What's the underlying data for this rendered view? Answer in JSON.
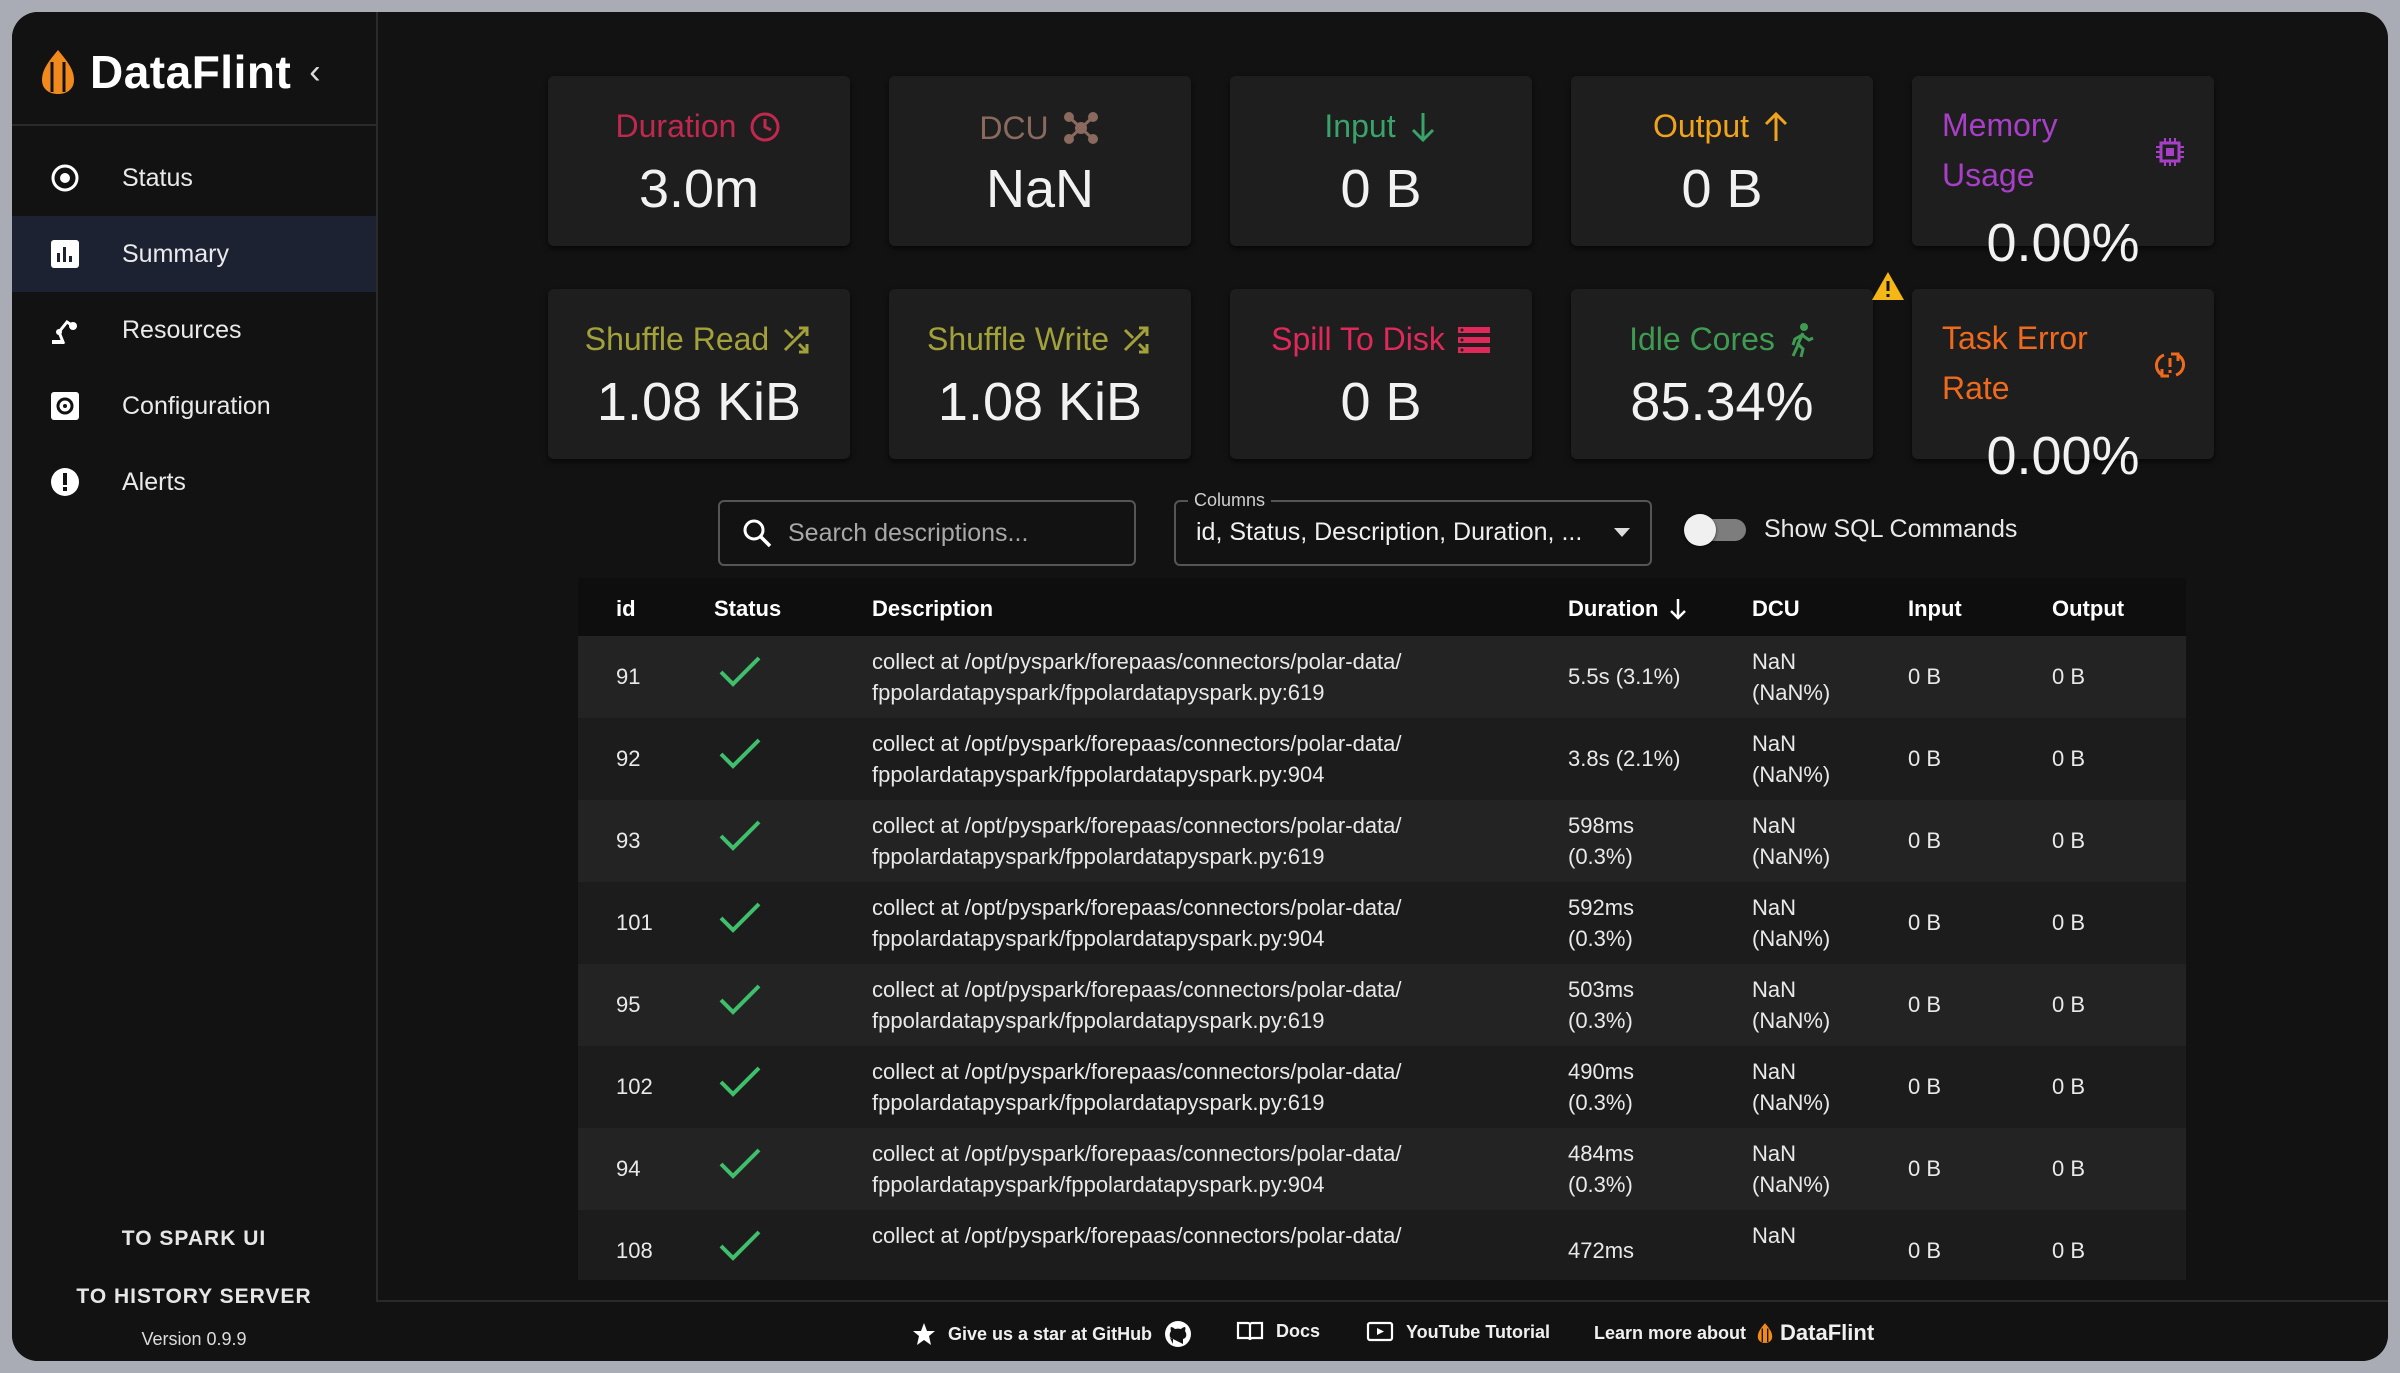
{
  "app": {
    "name": "DataFlint",
    "version": "Version 0.9.9"
  },
  "sidebar": {
    "items": [
      {
        "label": "Status",
        "icon": "status-icon"
      },
      {
        "label": "Summary",
        "icon": "summary-chart-icon",
        "active": true
      },
      {
        "label": "Resources",
        "icon": "resources-icon"
      },
      {
        "label": "Configuration",
        "icon": "configuration-icon"
      },
      {
        "label": "Alerts",
        "icon": "alert-icon"
      }
    ],
    "to_spark_ui": "TO SPARK UI",
    "to_history_server": "TO HISTORY SERVER"
  },
  "metrics": [
    {
      "title": "Duration",
      "value": "3.0m",
      "color": "#c0284e"
    },
    {
      "title": "DCU",
      "value": "NaN",
      "color": "#8a6a5e"
    },
    {
      "title": "Input",
      "value": "0 B",
      "color": "#39a36a"
    },
    {
      "title": "Output",
      "value": "0 B",
      "color": "#f0a41c"
    },
    {
      "title": "Memory Usage",
      "value": "0.00%",
      "color": "#a83fc7"
    },
    {
      "title": "Shuffle Read",
      "value": "1.08 KiB",
      "color": "#a3a13a"
    },
    {
      "title": "Shuffle Write",
      "value": "1.08 KiB",
      "color": "#a3a13a"
    },
    {
      "title": "Spill To Disk",
      "value": "0 B",
      "color": "#e0285a"
    },
    {
      "title": "Idle Cores",
      "value": "85.34%",
      "color": "#3f9a52",
      "warning": true
    },
    {
      "title": "Task Error Rate",
      "value": "0.00%",
      "color": "#ef6a1d"
    }
  ],
  "toolbar": {
    "search_placeholder": "Search descriptions...",
    "columns_label": "Columns",
    "columns_value": "id, Status, Description, Duration, ...",
    "show_sql_label": "Show SQL Commands",
    "show_sql_on": false
  },
  "table": {
    "headers": {
      "id": "id",
      "status": "Status",
      "description": "Description",
      "duration": "Duration",
      "dcu": "DCU",
      "input": "Input",
      "output": "Output"
    },
    "sort_column": "Duration",
    "rows": [
      {
        "id": "91",
        "status": "success",
        "desc1": "collect at /opt/pyspark/forepaas/connectors/polar-data/",
        "desc2": "fppolardatapyspark/fppolardatapyspark.py:619",
        "duration": "5.5s (3.1%)",
        "duration2": "",
        "dcu1": "NaN",
        "dcu2": "(NaN%)",
        "input": "0 B",
        "output": "0 B"
      },
      {
        "id": "92",
        "status": "success",
        "desc1": "collect at /opt/pyspark/forepaas/connectors/polar-data/",
        "desc2": "fppolardatapyspark/fppolardatapyspark.py:904",
        "duration": "3.8s (2.1%)",
        "duration2": "",
        "dcu1": "NaN",
        "dcu2": "(NaN%)",
        "input": "0 B",
        "output": "0 B"
      },
      {
        "id": "93",
        "status": "success",
        "desc1": "collect at /opt/pyspark/forepaas/connectors/polar-data/",
        "desc2": "fppolardatapyspark/fppolardatapyspark.py:619",
        "duration": "598ms",
        "duration2": "(0.3%)",
        "dcu1": "NaN",
        "dcu2": "(NaN%)",
        "input": "0 B",
        "output": "0 B"
      },
      {
        "id": "101",
        "status": "success",
        "desc1": "collect at /opt/pyspark/forepaas/connectors/polar-data/",
        "desc2": "fppolardatapyspark/fppolardatapyspark.py:904",
        "duration": "592ms",
        "duration2": "(0.3%)",
        "dcu1": "NaN",
        "dcu2": "(NaN%)",
        "input": "0 B",
        "output": "0 B"
      },
      {
        "id": "95",
        "status": "success",
        "desc1": "collect at /opt/pyspark/forepaas/connectors/polar-data/",
        "desc2": "fppolardatapyspark/fppolardatapyspark.py:619",
        "duration": "503ms",
        "duration2": "(0.3%)",
        "dcu1": "NaN",
        "dcu2": "(NaN%)",
        "input": "0 B",
        "output": "0 B"
      },
      {
        "id": "102",
        "status": "success",
        "desc1": "collect at /opt/pyspark/forepaas/connectors/polar-data/",
        "desc2": "fppolardatapyspark/fppolardatapyspark.py:619",
        "duration": "490ms",
        "duration2": "(0.3%)",
        "dcu1": "NaN",
        "dcu2": "(NaN%)",
        "input": "0 B",
        "output": "0 B"
      },
      {
        "id": "94",
        "status": "success",
        "desc1": "collect at /opt/pyspark/forepaas/connectors/polar-data/",
        "desc2": "fppolardatapyspark/fppolardatapyspark.py:904",
        "duration": "484ms",
        "duration2": "(0.3%)",
        "dcu1": "NaN",
        "dcu2": "(NaN%)",
        "input": "0 B",
        "output": "0 B"
      },
      {
        "id": "108",
        "status": "success",
        "desc1": "collect at /opt/pyspark/forepaas/connectors/polar-data/",
        "desc2": "",
        "duration": "472ms",
        "duration2": "",
        "dcu1": "NaN",
        "dcu2": "",
        "input": "0 B",
        "output": "0 B"
      }
    ]
  },
  "footer": {
    "github": "Give us a star at GitHub",
    "docs": "Docs",
    "youtube": "YouTube Tutorial",
    "learn_more": "Learn more about",
    "brand": "DataFlint"
  },
  "colors": {
    "background": "#121212",
    "card": "#1e1e1e",
    "success": "#3fbf6b",
    "active_nav": "#1d2233",
    "warning": "#f5b716"
  }
}
